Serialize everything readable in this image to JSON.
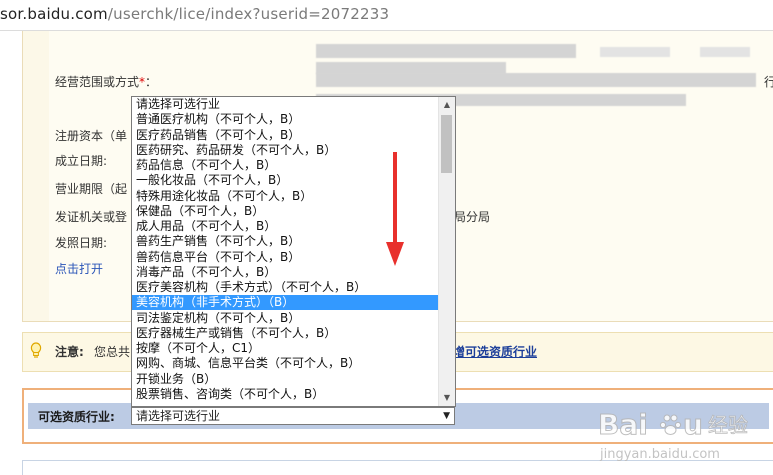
{
  "browser": {
    "url_host": "sor.baidu.com",
    "url_path": "/userchk/lice/index?userid=2072233"
  },
  "form": {
    "scope_label": "经营范围或方式",
    "scope_required": "*",
    "scope_colon": "：",
    "capital_label": "注册资本（单",
    "established_label": "成立日期:",
    "term_label": "营业期限（起",
    "issuer_label": "发证机关或登",
    "issuer_value_tail": "局分局",
    "issue_date_label": "发照日期:",
    "click_open": "点击打开",
    "right_tail_1": "行"
  },
  "notice": {
    "label": "注意:",
    "text": "您总共",
    "link": "增可选资质行业"
  },
  "industry_select": {
    "label": "可选资质行业:",
    "value": "请选择可选行业",
    "options": [
      "请选择可选行业",
      "普通医疗机构（不可个人，B）",
      "医疗药品销售（不可个人，B）",
      "医药研究、药品研发（不可个人，B）",
      "药品信息（不可个人，B）",
      "一般化妆品（不可个人，B）",
      "特殊用途化妆品（不可个人，B）",
      "保健品（不可个人，B）",
      "成人用品（不可个人，B）",
      "兽药生产销售（不可个人，B）",
      "兽药信息平台（不可个人，B）",
      "消毒产品（不可个人，B）",
      "医疗美容机构（手术方式）（不可个人，B）",
      "美容机构（非手术方式）（B）",
      "司法鉴定机构（不可个人，B）",
      "医疗器械生产或销售（不可个人，B）",
      "按摩（不可个人，C1）",
      "网购、商城、信息平台类（不可个人，B）",
      "开锁业务（B）",
      "股票销售、咨询类（不可个人，B）"
    ],
    "highlighted_index": 13
  },
  "watermark": {
    "brand": "Bai",
    "brand_tail": "u",
    "cn": "经验",
    "domain": "jingyan.baidu.com"
  },
  "colors": {
    "highlight": "#3399ff",
    "link": "#2a55b8",
    "red_arrow": "#e8302c",
    "notice_bg": "#fdf8e4",
    "select_bar": "#bccbe4",
    "orange_border": "#efb07a"
  },
  "icons": [
    "lightbulb-icon",
    "red-arrow-down-icon",
    "scroll-up-icon",
    "scroll-down-icon",
    "dropdown-arrow-icon",
    "baidu-paw-icon"
  ]
}
